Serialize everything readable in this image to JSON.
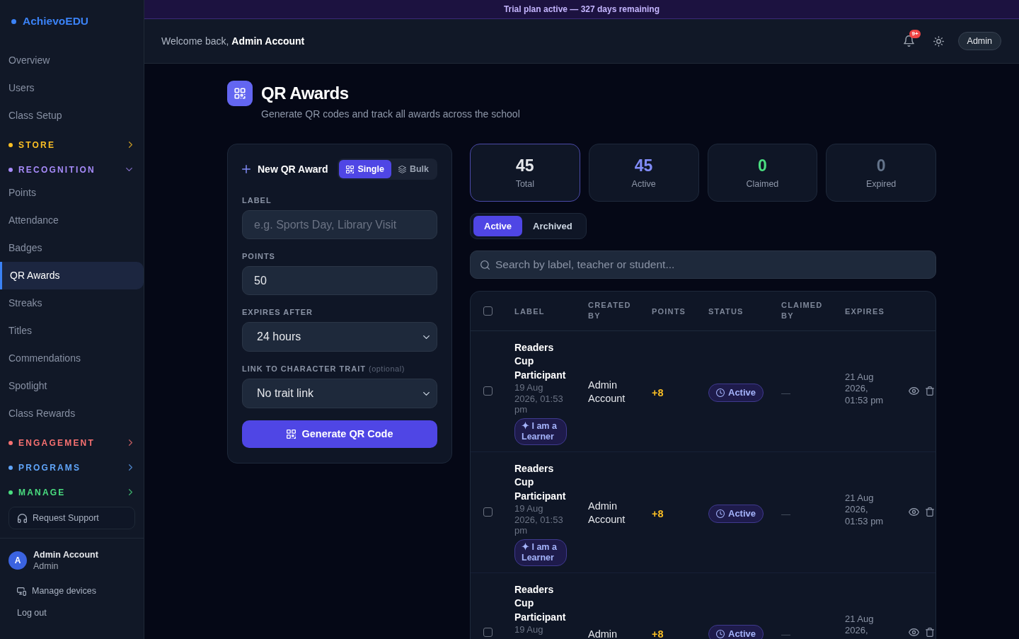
{
  "sidebar": {
    "logo": "AchievoEDU",
    "items": [
      {
        "kind": "link",
        "label": "Overview",
        "selected": false
      },
      {
        "kind": "link",
        "label": "Users",
        "selected": false
      },
      {
        "kind": "link",
        "label": "Class Setup",
        "selected": false
      },
      {
        "kind": "section",
        "label": "STORE",
        "color": "#fbbf24",
        "expanded": false
      },
      {
        "kind": "section",
        "label": "RECOGNITION",
        "color": "#a78bfa",
        "expanded": true,
        "children": [
          {
            "kind": "link",
            "label": "Points",
            "selected": false
          },
          {
            "kind": "link",
            "label": "Attendance",
            "selected": false
          },
          {
            "kind": "link",
            "label": "Badges",
            "selected": false
          },
          {
            "kind": "link",
            "label": "QR Awards",
            "selected": true
          },
          {
            "kind": "link",
            "label": "Streaks",
            "selected": false
          },
          {
            "kind": "link",
            "label": "Titles",
            "selected": false
          },
          {
            "kind": "link",
            "label": "Commendations",
            "selected": false
          },
          {
            "kind": "link",
            "label": "Spotlight",
            "selected": false
          },
          {
            "kind": "link",
            "label": "Class Rewards",
            "selected": false
          }
        ]
      },
      {
        "kind": "section",
        "label": "ENGAGEMENT",
        "color": "#f87171",
        "expanded": false
      },
      {
        "kind": "section",
        "label": "PROGRAMS",
        "color": "#60a5fa",
        "expanded": false
      },
      {
        "kind": "section",
        "label": "MANAGE",
        "color": "#4ade80",
        "expanded": false
      }
    ],
    "support_button": "Request Support",
    "user": {
      "initial": "A",
      "name": "Admin Account",
      "role": "Admin"
    },
    "footer_links": [
      {
        "kind": "devices",
        "label": "Manage devices"
      },
      {
        "kind": "logout",
        "label": "Log out"
      }
    ]
  },
  "banner": "Trial plan active — 327 days remaining",
  "header": {
    "welcome": "Welcome back, **Admin Account**",
    "notification_count": "9+",
    "user_button": "Admin"
  },
  "page": {
    "title": "QR Awards",
    "subtitle": "Generate QR codes and track all awards across the school"
  },
  "form": {
    "title": "New QR Award",
    "modes": [
      {
        "kind": "single",
        "label": "Single",
        "selected": true
      },
      {
        "kind": "bulk",
        "label": "Bulk",
        "selected": false
      }
    ],
    "fields": [
      {
        "kind": "input",
        "label": "LABEL",
        "placeholder": "e.g. Sports Day, Library Visit"
      },
      {
        "kind": "input",
        "label": "POINTS",
        "value": "50"
      },
      {
        "kind": "select",
        "label": "EXPIRES AFTER",
        "value": "24 hours"
      },
      {
        "kind": "select",
        "label": "LINK TO CHARACTER TRAIT",
        "hint": "(optional)",
        "value": "No trait link"
      }
    ],
    "submit": "Generate QR Code"
  },
  "stats": [
    {
      "value": "45",
      "label": "Total",
      "color": "#e5e7eb",
      "selected": true
    },
    {
      "value": "45",
      "label": "Active",
      "color": "#818cf8",
      "selected": false
    },
    {
      "value": "0",
      "label": "Claimed",
      "color": "#4ade80",
      "selected": false
    },
    {
      "value": "0",
      "label": "Expired",
      "color": "#64748b",
      "selected": false
    }
  ],
  "tabs": [
    {
      "label": "Active",
      "selected": true
    },
    {
      "label": "Archived",
      "selected": false
    }
  ],
  "search": {
    "placeholder": "Search by label, teacher or student..."
  },
  "table": {
    "header_checked": false,
    "columns": [
      "LABEL",
      "CREATED BY",
      "POINTS",
      "STATUS",
      "CLAIMED BY",
      "EXPIRES"
    ],
    "rows": [
      {
        "checked": false,
        "label": "Readers Cup Participant",
        "created": "19 Aug 2026, 01:53 pm",
        "trait": "✦ I am a Learner",
        "created_by": "Admin Account",
        "points": "+8",
        "status": "Active",
        "claimed_by": "—",
        "expires": "21 Aug 2026, 01:53 pm"
      },
      {
        "checked": false,
        "label": "Readers Cup Participant",
        "created": "19 Aug 2026, 01:53 pm",
        "trait": "✦ I am a Learner",
        "created_by": "Admin Account",
        "points": "+8",
        "status": "Active",
        "claimed_by": "—",
        "expires": "21 Aug 2026, 01:53 pm"
      },
      {
        "checked": false,
        "label": "Readers Cup Participant",
        "created": "19 Aug",
        "created_by": "Admin",
        "points": "+8",
        "status": "Active",
        "claimed_by": "—",
        "expires": "21 Aug 2026,"
      }
    ]
  }
}
